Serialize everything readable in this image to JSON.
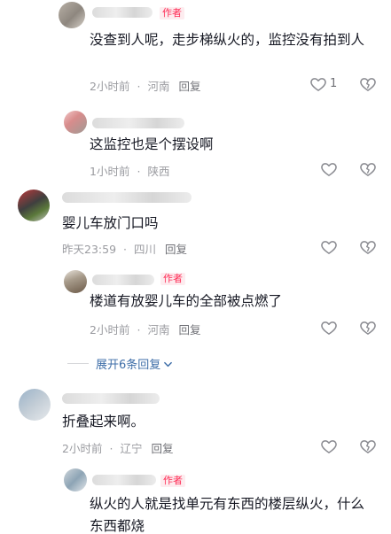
{
  "labels": {
    "author": "作者",
    "reply": "回复"
  },
  "comments": [
    {
      "text": "没查到人呢，走步梯纵火的，监控没有拍到人",
      "time": "2小时前",
      "location": "河南",
      "likes": "1"
    },
    {
      "text": "这监控也是个摆设啊",
      "time": "1小时前",
      "location": "陕西",
      "likes": ""
    },
    {
      "text": "婴儿车放门口吗",
      "time": "昨天23:59",
      "location": "四川",
      "likes": ""
    },
    {
      "text": "楼道有放婴儿车的全部被点燃了",
      "time": "2小时前",
      "location": "河南",
      "likes": ""
    },
    {
      "text": "折叠起来啊。",
      "time": "2小时前",
      "location": "辽宁",
      "likes": ""
    },
    {
      "text": "纵火的人就是找单元有东西的楼层纵火，什么东西都烧",
      "time": "",
      "location": "",
      "likes": ""
    }
  ],
  "expand_replies": "展开6条回复",
  "icons": {
    "like": "heart-outline-icon",
    "dislike": "dislike-outline-icon",
    "expand": "chevron-down-icon"
  },
  "colors": {
    "author_tag": "#fe2c55",
    "link": "#3e6ea8",
    "meta": "#9a9ba0"
  }
}
